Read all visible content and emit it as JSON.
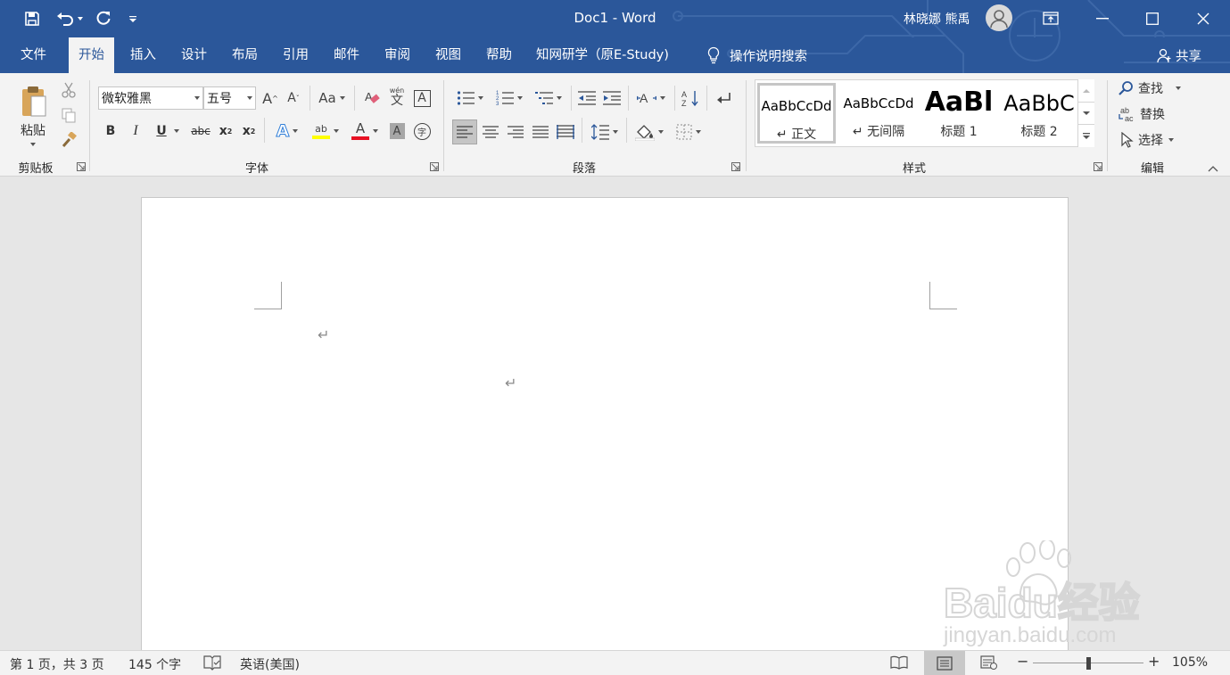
{
  "title_bar": {
    "document_title": "Doc1  -  Word",
    "user_name": "林晓娜 熊禹",
    "quick_access": [
      "save-icon",
      "undo-icon",
      "redo-icon",
      "customize-icon"
    ]
  },
  "tabs": [
    "文件",
    "开始",
    "插入",
    "设计",
    "布局",
    "引用",
    "邮件",
    "审阅",
    "视图",
    "帮助",
    "知网研学（原E-Study)"
  ],
  "active_tab": "开始",
  "tell_me": "操作说明搜索",
  "share": "共享",
  "ribbon": {
    "clipboard": {
      "label": "剪贴板",
      "paste": "粘贴"
    },
    "font": {
      "label": "字体",
      "font_name": "微软雅黑",
      "font_size": "五号",
      "grow": "A",
      "shrink": "A",
      "change_case": "Aa",
      "bold": "B",
      "italic": "I",
      "underline": "U",
      "strikethrough": "abc",
      "subscript": "x",
      "subscript_mark": "2",
      "superscript": "x",
      "superscript_mark": "2",
      "text_effects": "A",
      "font_color": "A",
      "char_shading": "A",
      "enclose": "字",
      "char_border": "A",
      "phonetic_top": "wén",
      "phonetic_char": "文",
      "highlight_label": "ab",
      "highlight_color": "#ffff00",
      "font_color_value": "#e81123"
    },
    "paragraph": {
      "label": "段落"
    },
    "styles": {
      "label": "样式",
      "items": [
        {
          "preview": "AaBbCcDd",
          "name": "↵ 正文"
        },
        {
          "preview": "AaBbCcDd",
          "name": "↵ 无间隔"
        },
        {
          "preview": "AaBl",
          "name": "标题 1"
        },
        {
          "preview": "AaBbC",
          "name": "标题 2"
        }
      ]
    },
    "editing": {
      "label": "编辑",
      "find": "查找",
      "replace": "替换",
      "select": "选择"
    }
  },
  "document": {
    "paragraph_marks": [
      "↵",
      "↵"
    ]
  },
  "watermark": {
    "brand": "Baidu经验",
    "url": "jingyan.baidu.com"
  },
  "status_bar": {
    "page": "第 1 页，共 3 页",
    "words": "145 个字",
    "language": "英语(美国)",
    "zoom": "105%",
    "zoom_level": 105
  },
  "colors": {
    "brand": "#2b579a",
    "ribbon_bg": "#f3f3f3",
    "doc_bg": "#e6e6e6"
  }
}
